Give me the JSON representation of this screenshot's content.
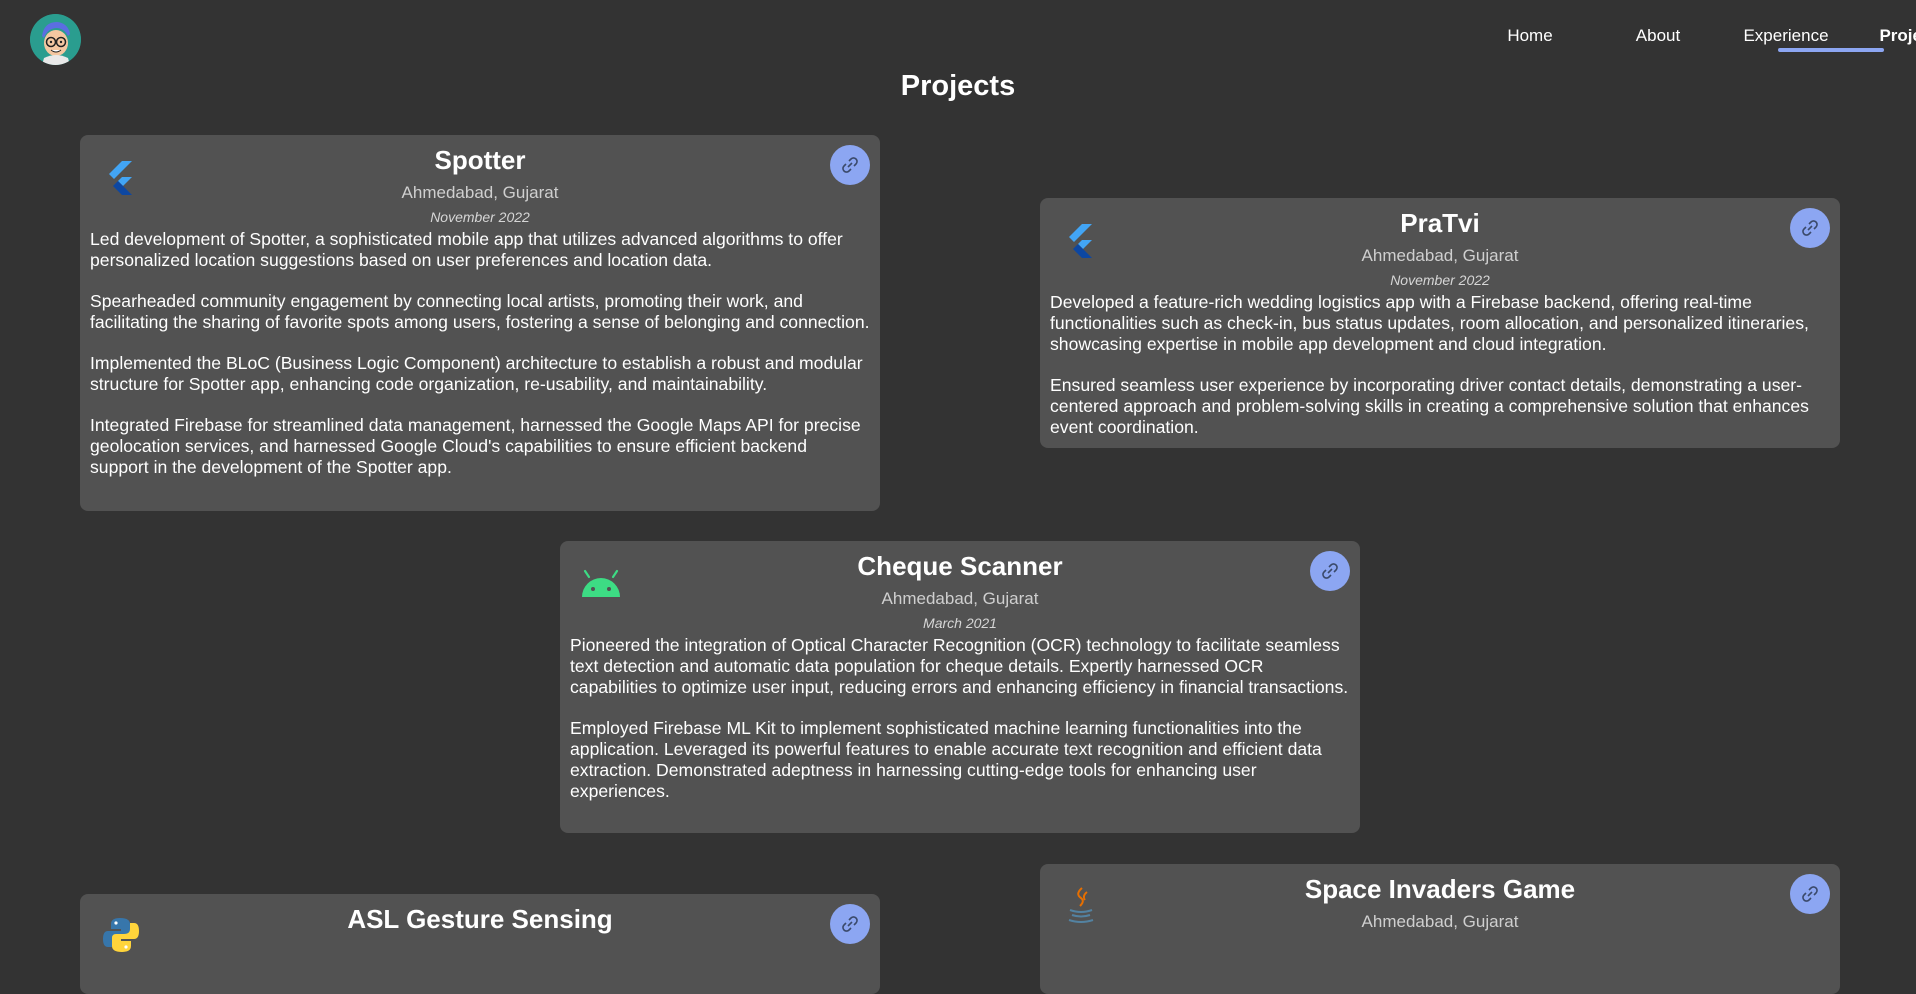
{
  "nav": {
    "items": [
      {
        "label": "Home"
      },
      {
        "label": "About"
      },
      {
        "label": "Experience"
      },
      {
        "label": "Projects"
      }
    ]
  },
  "page": {
    "title": "Projects"
  },
  "projects": [
    {
      "title": "Spotter",
      "location": "Ahmedabad, Gujarat",
      "date": "November 2022",
      "icon": "flutter-icon",
      "paragraphs": [
        "Led development of Spotter, a sophisticated mobile app that utilizes advanced algorithms to offer personalized location suggestions based on user preferences and location data.",
        "Spearheaded community engagement by connecting local artists, promoting their work, and facilitating the sharing of favorite spots among users, fostering a sense of belonging and connection.",
        "Implemented the BLoC (Business Logic Component) architecture to establish a robust and modular structure for Spotter app, enhancing code organization, re-usability, and maintainability.",
        "Integrated Firebase for streamlined data management, harnessed the Google Maps API for precise geolocation services, and harnessed Google Cloud's capabilities to ensure efficient backend support in the development of the Spotter app."
      ]
    },
    {
      "title": "PraTvi",
      "location": "Ahmedabad, Gujarat",
      "date": "November 2022",
      "icon": "flutter-icon",
      "paragraphs": [
        "Developed a feature-rich wedding logistics app with a Firebase backend, offering real-time functionalities such as check-in, bus status updates, room allocation, and personalized itineraries, showcasing expertise in mobile app development and cloud integration.",
        "Ensured seamless user experience by incorporating driver contact details, demonstrating a user-centered approach and problem-solving skills in creating a comprehensive solution that enhances event coordination."
      ]
    },
    {
      "title": "Cheque Scanner",
      "location": "Ahmedabad, Gujarat",
      "date": "March 2021",
      "icon": "android-icon",
      "paragraphs": [
        "Pioneered the integration of Optical Character Recognition (OCR) technology to facilitate seamless text detection and automatic data population for cheque details. Expertly harnessed OCR capabilities to optimize user input, reducing errors and enhancing efficiency in financial transactions.",
        "Employed Firebase ML Kit to implement sophisticated machine learning functionalities into the application. Leveraged its powerful features to enable accurate text recognition and efficient data extraction. Demonstrated adeptness in harnessing cutting-edge tools for enhancing user experiences."
      ]
    },
    {
      "title": "ASL Gesture Sensing",
      "icon": "python-icon",
      "paragraphs": []
    },
    {
      "title": "Space Invaders Game",
      "location": "Ahmedabad, Gujarat",
      "icon": "java-icon",
      "paragraphs": []
    }
  ],
  "colors": {
    "background": "#333333",
    "card": "#525252",
    "accent": "#8ca6f2"
  }
}
